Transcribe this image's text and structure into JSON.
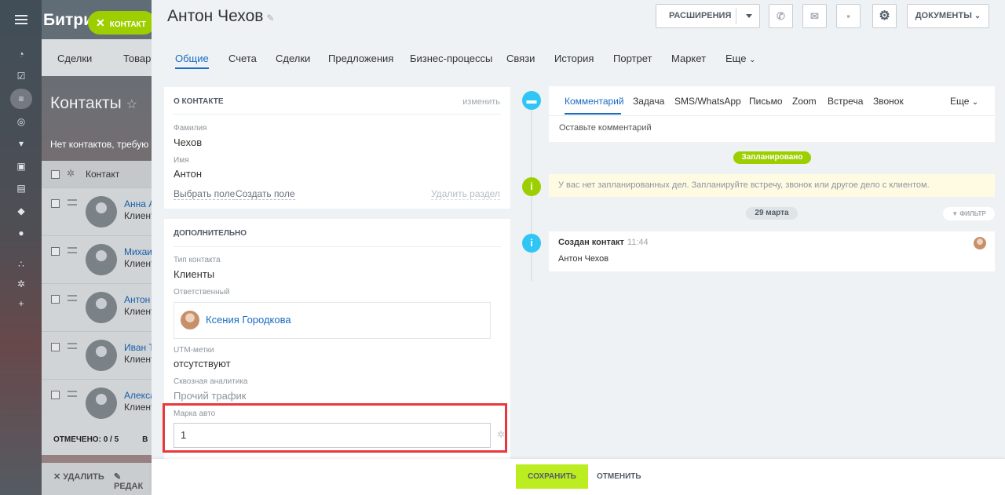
{
  "background": {
    "logo": "Битри",
    "close_chip": "КОНТАКТ",
    "tabs": [
      "Сделки",
      "Товар"
    ],
    "page_title": "Контакты",
    "note": "Нет контактов, требую",
    "table_header": "Контакт",
    "rows": [
      {
        "name": "Анна А",
        "type": "Клиент"
      },
      {
        "name": "Михаил",
        "type": "Клиент"
      },
      {
        "name": "Антон Ч",
        "type": "Клиент"
      },
      {
        "name": "Иван Ту",
        "type": "Клиент"
      },
      {
        "name": "Алекса",
        "type": "Клиент"
      }
    ],
    "marked": "ОТМЕЧЕНО: 0 / 5",
    "marked_tail": "В",
    "delete": "✕ УДАЛИТЬ",
    "edit": "✎ РЕДАК"
  },
  "header": {
    "title": "Антон  Чехов",
    "extensions": "РАСШИРЕНИЯ",
    "documents": "ДОКУМЕНТЫ"
  },
  "tabs": [
    "Общие",
    "Счета",
    "Сделки",
    "Предложения",
    "Бизнес-процессы",
    "Связи",
    "История",
    "Портрет",
    "Маркет",
    "Еще"
  ],
  "about": {
    "heading": "О КОНТАКТЕ",
    "edit_link": "изменить",
    "lastname_label": "Фамилия",
    "lastname_value": "Чехов",
    "firstname_label": "Имя",
    "firstname_value": "Антон",
    "choose_field": "Выбрать поле",
    "create_field": "Создать поле",
    "delete_section": "Удалить раздел"
  },
  "extra": {
    "heading": "ДОПОЛНИТЕЛЬНО",
    "type_label": "Тип контакта",
    "type_value": "Клиенты",
    "responsible_label": "Ответственный",
    "responsible_name": "Ксения Городкова",
    "utm_label": "UTM-метки",
    "utm_value": "отсутствуют",
    "analytics_label": "Сквозная аналитика",
    "analytics_value": "Прочий трафик",
    "car_label": "Марка авто",
    "car_value": "1"
  },
  "activity": {
    "tabs": [
      "Комментарий",
      "Задача",
      "SMS/WhatsApp",
      "Письмо",
      "Zoom",
      "Встреча",
      "Звонок",
      "Еще"
    ],
    "placeholder": "Оставьте комментарий"
  },
  "timeline": {
    "planned": "Запланировано",
    "empty_notice": "У вас нет запланированных дел. Запланируйте встречу, звонок или другое дело с клиентом.",
    "date": "29 марта",
    "filter": "ФИЛЬТР",
    "event_title": "Создан контакт",
    "event_time": "11:44",
    "event_body": "Антон Чехов"
  },
  "footer": {
    "save": "СОХРАНИТЬ",
    "cancel": "ОТМЕНИТЬ"
  },
  "colors": {
    "accent_green": "#bbed21",
    "link_blue": "#1a6bc2",
    "timeline_blue": "#2fc6f6",
    "timeline_green": "#9dcf00",
    "highlight_red": "#e8383d"
  }
}
